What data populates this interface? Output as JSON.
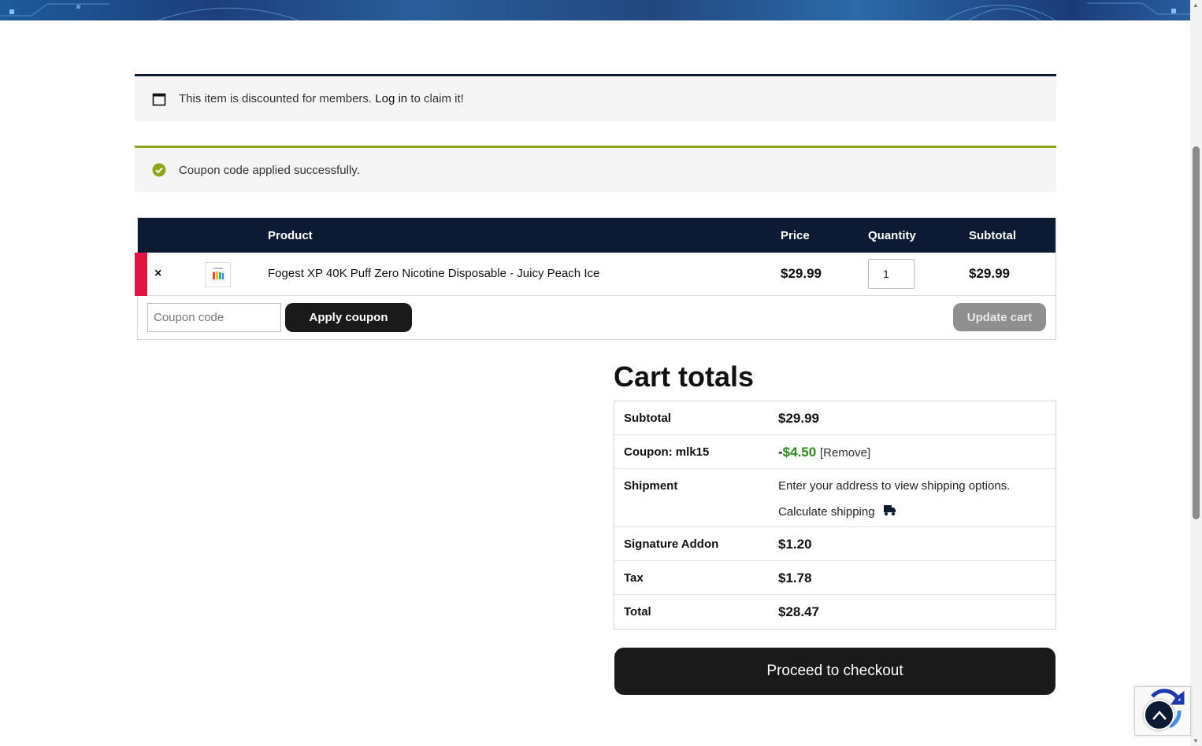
{
  "notices": {
    "member": {
      "text_before": "This item is discounted for members.",
      "link": "Log in",
      "text_after": "to claim it!"
    },
    "coupon_ok": {
      "text": "Coupon code applied successfully."
    }
  },
  "cart": {
    "headers": {
      "product": "Product",
      "price": "Price",
      "quantity": "Quantity",
      "subtotal": "Subtotal"
    },
    "items": [
      {
        "name": "Fogest XP 40K Puff Zero Nicotine Disposable - Juicy Peach Ice",
        "price": "$29.99",
        "quantity": "1",
        "subtotal": "$29.99"
      }
    ],
    "remove_glyph": "×",
    "coupon_placeholder": "Coupon code",
    "apply_label": "Apply coupon",
    "update_label": "Update cart"
  },
  "totals": {
    "title": "Cart totals",
    "subtotal_label": "Subtotal",
    "subtotal": "$29.99",
    "coupon_label": "Coupon: mlk15",
    "coupon_sign": "-",
    "coupon_amount": "$4.50",
    "coupon_remove": "[Remove]",
    "shipment_label": "Shipment",
    "shipment_text": "Enter your address to view shipping options.",
    "calc_shipping": "Calculate shipping",
    "signature_label": "Signature Addon",
    "signature": "$1.20",
    "tax_label": "Tax",
    "tax": "$1.78",
    "total_label": "Total",
    "total": "$28.47",
    "checkout_label": "Proceed to checkout"
  },
  "colors": {
    "header_navy": "#0d1a33",
    "success_green": "#8fa51d",
    "discount_green": "#2a8a1a",
    "remove_red": "#e01640"
  }
}
